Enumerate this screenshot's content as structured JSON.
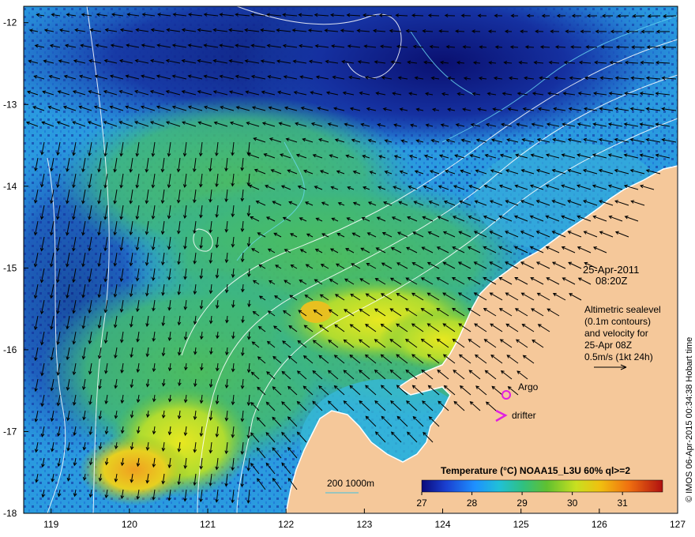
{
  "map": {
    "lon_ticks": [
      "119",
      "120",
      "121",
      "122",
      "123",
      "124",
      "125",
      "126",
      "127"
    ],
    "lat_ticks": [
      "-12",
      "-13",
      "-14",
      "-15",
      "-16",
      "-17",
      "-18"
    ],
    "lon_range": [
      118.65,
      127.0
    ],
    "lat_range": [
      -18.0,
      -11.8
    ]
  },
  "annotation": {
    "date": "25-Apr-2011",
    "time": "08:20Z",
    "legend_lines": [
      "Altimetric sealevel",
      "(0.1m contours)",
      "and velocity for",
      "25-Apr 08Z",
      "0.5m/s (1kt 24h)"
    ]
  },
  "markers": {
    "argo_label": "Argo",
    "drifter_label": "drifter",
    "argo_color": "#e020e0",
    "drifter_color": "#e020e0"
  },
  "depth_legend": {
    "label": "200  1000m",
    "color": "#40c0e0"
  },
  "colorbar": {
    "title": "Temperature (°C) NOAA15_L3U 60% ql>=2",
    "ticks": [
      "27",
      "28",
      "29",
      "30",
      "31"
    ],
    "range": [
      27,
      31.8
    ],
    "colors": [
      "#0a0a7a",
      "#1a3fd0",
      "#1e90ff",
      "#20c0d8",
      "#30c080",
      "#60c030",
      "#c8e020",
      "#f0c010",
      "#f07010",
      "#b01010"
    ]
  },
  "credit": "© IMOS 06-Apr-2015 00:34:38 Hobart time",
  "colors": {
    "land": "#f5c89a",
    "cold": "#101880",
    "mid": "#2aa0e0",
    "warm": "#40c060",
    "hot": "#e8e020"
  }
}
